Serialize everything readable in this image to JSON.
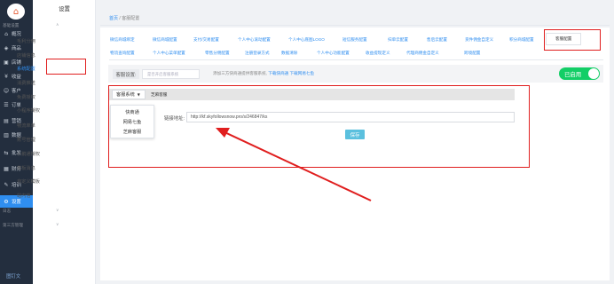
{
  "rail": {
    "items": [
      {
        "icon": "⌂",
        "label": "概况"
      },
      {
        "icon": "◈",
        "label": "商品"
      },
      {
        "icon": "▣",
        "label": "店铺"
      },
      {
        "icon": "¥",
        "label": "收益"
      },
      {
        "icon": "☺",
        "label": "客户"
      },
      {
        "icon": "☰",
        "label": "订单"
      },
      {
        "icon": "▤",
        "label": "营销"
      },
      {
        "icon": "▥",
        "label": "数据"
      },
      {
        "icon": "⇆",
        "label": "批发"
      },
      {
        "icon": "▦",
        "label": "财务"
      },
      {
        "icon": "✎",
        "label": "培训"
      },
      {
        "icon": "⚙",
        "label": "设置"
      }
    ],
    "bottom_label": "图钉文"
  },
  "sidebar": {
    "title": "设置",
    "group1": "基础设置",
    "items": [
      "毛利分佣",
      "店铺信息",
      "系统配置",
      "消费推送",
      "免费授权",
      "小程序授权",
      "物流单单",
      "账号管理",
      "小鹅通授权",
      "模板消息",
      "自定义模板",
      "站内信"
    ],
    "group2": "日志",
    "group3": "第三方管理",
    "caret": "∨"
  },
  "breadcrumb": {
    "home": "首页",
    "sep": "/",
    "current": "客服配置"
  },
  "tabs": {
    "row1": [
      "微信商城绑定",
      "微信商城配置",
      "支付/交易配置",
      "个人中心滚动配置",
      "个人中心底图LOGO",
      "短信服务配置",
      "扫单云配置",
      "售后云配置",
      "货件佣金自定义",
      "积分商城配置",
      "客服配置"
    ],
    "row2": [
      "物流查询配置",
      "个人中心菜单配置",
      "零售分佣配置",
      "注册登录方式",
      "数据清除",
      "个人中心功能配置",
      "收益提现定义",
      "代理商佣金自定义",
      "跨境配置"
    ]
  },
  "settings": {
    "label": "客服设置:",
    "placeholder": "是否开启客服系统",
    "tip_prefix": "添加三方快商通提供客服系统,",
    "tip_link1": "下载快商通",
    "tip_link2": "下载网易七鱼",
    "toggle_label": "已启用",
    "toggle_on": true,
    "toggle_color": "#13ce66"
  },
  "form": {
    "select_label": "客服系统",
    "select_value": "芝麻客服",
    "options": [
      "快商通",
      "网易七鱼",
      "芝麻客服"
    ],
    "url_label": "链接地址:",
    "url_value": "http://kf.skyfollowsnow.pro/s/246847/ks",
    "save_label": "保存"
  },
  "colors": {
    "accent": "#2f8ef0",
    "highlight": "#e01e1e",
    "rail": "#232e3e"
  }
}
